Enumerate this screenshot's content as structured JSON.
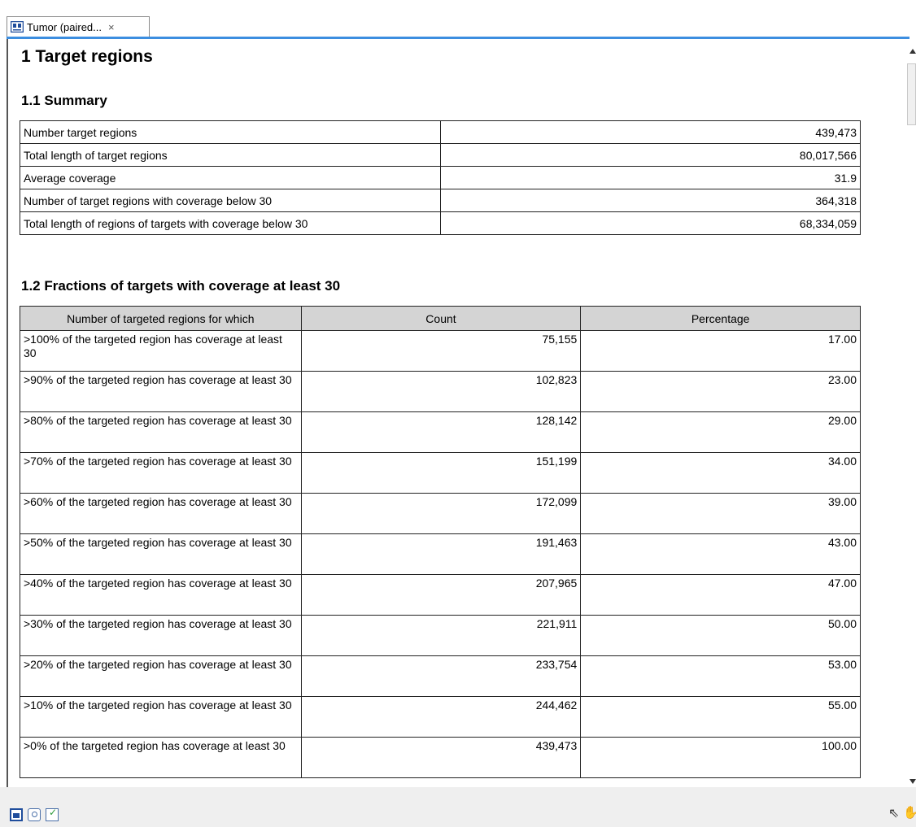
{
  "tab": {
    "title": "Tumor (paired...",
    "close": "×",
    "icon": "report-icon"
  },
  "sections": {
    "h1": "1 Target regions",
    "summary_title": "1.1 Summary",
    "fractions_title": "1.2 Fractions of targets with coverage at least 30"
  },
  "summary": [
    {
      "label": "Number target regions",
      "value": "439,473"
    },
    {
      "label": "Total length of target regions",
      "value": "80,017,566"
    },
    {
      "label": "Average coverage",
      "value": "31.9"
    },
    {
      "label": "Number of target regions with coverage below 30",
      "value": "364,318"
    },
    {
      "label": "Total length of regions of targets with coverage below 30",
      "value": "68,334,059"
    }
  ],
  "fractions": {
    "headers": [
      "Number of targeted regions for which",
      "Count",
      "Percentage"
    ],
    "rows": [
      {
        "label": ">100% of the targeted region has coverage at least 30",
        "count": "75,155",
        "pct": "17.00"
      },
      {
        "label": ">90% of the targeted region has coverage at least 30",
        "count": "102,823",
        "pct": "23.00"
      },
      {
        "label": ">80% of the targeted region has coverage at least 30",
        "count": "128,142",
        "pct": "29.00"
      },
      {
        "label": ">70% of the targeted region has coverage at least 30",
        "count": "151,199",
        "pct": "34.00"
      },
      {
        "label": ">60% of the targeted region has coverage at least 30",
        "count": "172,099",
        "pct": "39.00"
      },
      {
        "label": ">50% of the targeted region has coverage at least 30",
        "count": "191,463",
        "pct": "43.00"
      },
      {
        "label": ">40% of the targeted region has coverage at least 30",
        "count": "207,965",
        "pct": "47.00"
      },
      {
        "label": ">30% of the targeted region has coverage at least 30",
        "count": "221,911",
        "pct": "50.00"
      },
      {
        "label": ">20% of the targeted region has coverage at least 30",
        "count": "233,754",
        "pct": "53.00"
      },
      {
        "label": ">10% of the targeted region has coverage at least 30",
        "count": "244,462",
        "pct": "55.00"
      },
      {
        "label": ">0% of the targeted region has coverage at least 30",
        "count": "439,473",
        "pct": "100.00"
      }
    ]
  },
  "bottom_bar": {
    "icons": [
      "report-view-icon",
      "history-icon",
      "element-info-icon"
    ],
    "right_icons": [
      "selection-mode-icon",
      "pan-mode-icon"
    ],
    "cursor_glyph": "⇖",
    "hand_glyph": "✋"
  }
}
